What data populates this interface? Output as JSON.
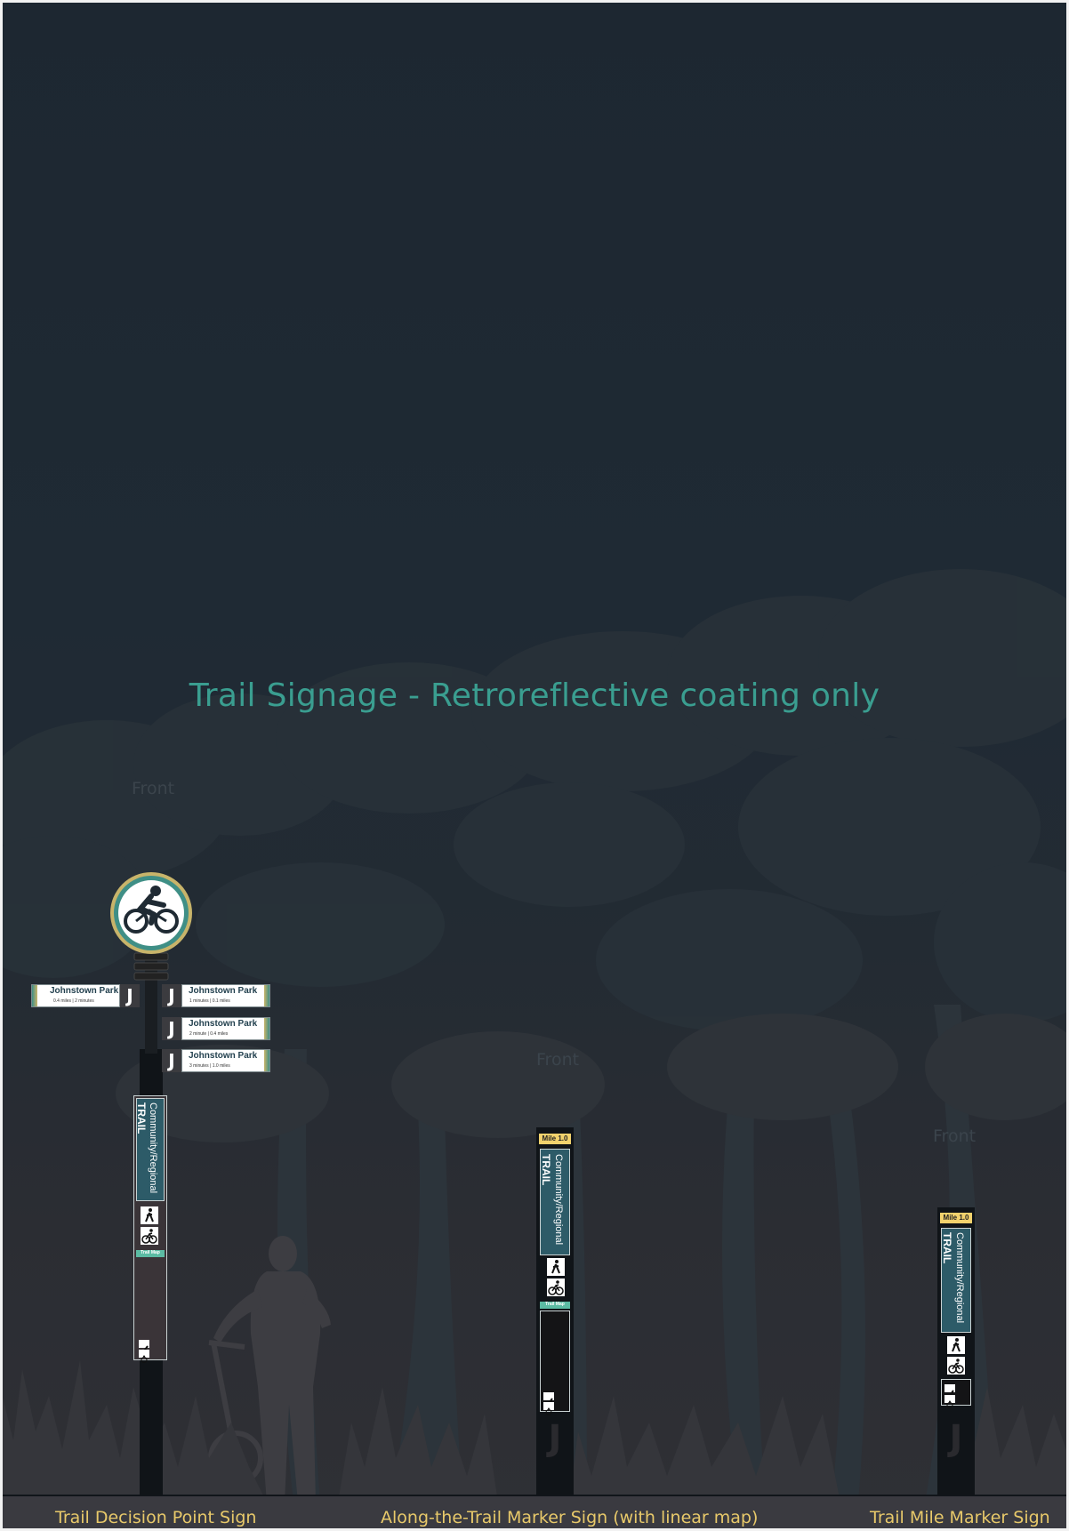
{
  "title": "Trail Signage - Retroreflective coating only",
  "front_label": "Front",
  "signs": {
    "decision_point": {
      "caption": "Trail Decision Point Sign",
      "blades": [
        {
          "destination": "Johnstown Park",
          "info": "0.4 miles  |  2 minutes",
          "letter": "J"
        },
        {
          "destination": "Johnstown Park",
          "info": "1 minutes  |  0.1 miles",
          "letter": "J"
        },
        {
          "destination": "Johnstown Park",
          "info": "2 minute  |  0.4 miles",
          "letter": "J"
        },
        {
          "destination": "Johnstown Park",
          "info": "3 minutes  |  1.0 miles",
          "letter": "J"
        }
      ],
      "panel": {
        "line1": "Community/Regional",
        "line2": "TRAIL",
        "map_label": "Trail Map"
      }
    },
    "along_trail": {
      "caption": "Along-the-Trail Marker Sign (with linear map)",
      "mile": "Mile 1.0",
      "panel": {
        "line1": "Community/Regional",
        "line2": "TRAIL",
        "map_label": "Trail Map"
      },
      "letter": "J"
    },
    "mile_marker": {
      "caption": "Trail Mile Marker Sign",
      "mile": "Mile 1.0",
      "panel": {
        "line1": "Community/Regional",
        "line2": "TRAIL"
      },
      "letter": "J"
    }
  },
  "icons": [
    "bicycle-rider-icon",
    "pedestrian-icon",
    "bicycle-icon",
    "check-icon",
    "wheelchair-icon"
  ],
  "colors": {
    "background": "#1d2731",
    "title": "#3a9e90",
    "caption": "#e8c96a",
    "panel": "#2d5b68",
    "mile_tag": "#f2d26d",
    "trail_map_tag": "#5bbba3",
    "post": "#101418"
  }
}
